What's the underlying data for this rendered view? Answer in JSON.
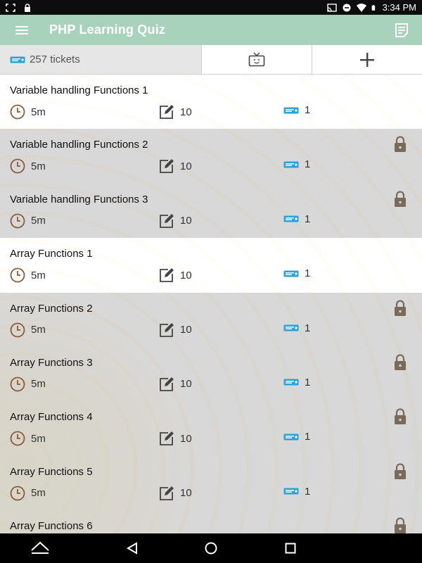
{
  "status_bar": {
    "time": "3:34 PM"
  },
  "toolbar": {
    "title": "PHP Learning Quiz"
  },
  "tickets": {
    "count_label": "257 tickets"
  },
  "quizzes": [
    {
      "name": "Variable handling Functions 1",
      "duration": "5m",
      "questions": "10",
      "tickets": "1",
      "locked": false
    },
    {
      "name": "Variable handling Functions 2",
      "duration": "5m",
      "questions": "10",
      "tickets": "1",
      "locked": true
    },
    {
      "name": "Variable handling Functions 3",
      "duration": "5m",
      "questions": "10",
      "tickets": "1",
      "locked": true
    },
    {
      "name": "Array Functions 1",
      "duration": "5m",
      "questions": "10",
      "tickets": "1",
      "locked": false
    },
    {
      "name": "Array Functions 2",
      "duration": "5m",
      "questions": "10",
      "tickets": "1",
      "locked": true
    },
    {
      "name": "Array Functions 3",
      "duration": "5m",
      "questions": "10",
      "tickets": "1",
      "locked": true
    },
    {
      "name": "Array Functions 4",
      "duration": "5m",
      "questions": "10",
      "tickets": "1",
      "locked": true
    },
    {
      "name": "Array Functions 5",
      "duration": "5m",
      "questions": "10",
      "tickets": "1",
      "locked": true
    },
    {
      "name": "Array Functions 6",
      "duration": "",
      "questions": "",
      "tickets": "",
      "locked": true
    }
  ],
  "icons": {
    "status_left": [
      "screenshot-icon",
      "lock-icon"
    ],
    "status_right": [
      "cast-icon",
      "dnd-icon",
      "wifi-icon",
      "battery-icon"
    ],
    "toolbar": [
      "menu-icon",
      "notes-icon"
    ],
    "actions": [
      "tv-icon",
      "add-icon"
    ],
    "item_meta": [
      "clock-icon",
      "edit-icon",
      "ticket-icon"
    ],
    "nav": [
      "nav-home-icon",
      "nav-back-icon",
      "nav-circle-icon",
      "nav-recents-icon"
    ]
  },
  "colors": {
    "toolbar": "#a9d2bd",
    "locked_row": "#d0d0d0",
    "icon_brown": "#8a5a3c",
    "ticket_blue": "#29a3d8"
  }
}
